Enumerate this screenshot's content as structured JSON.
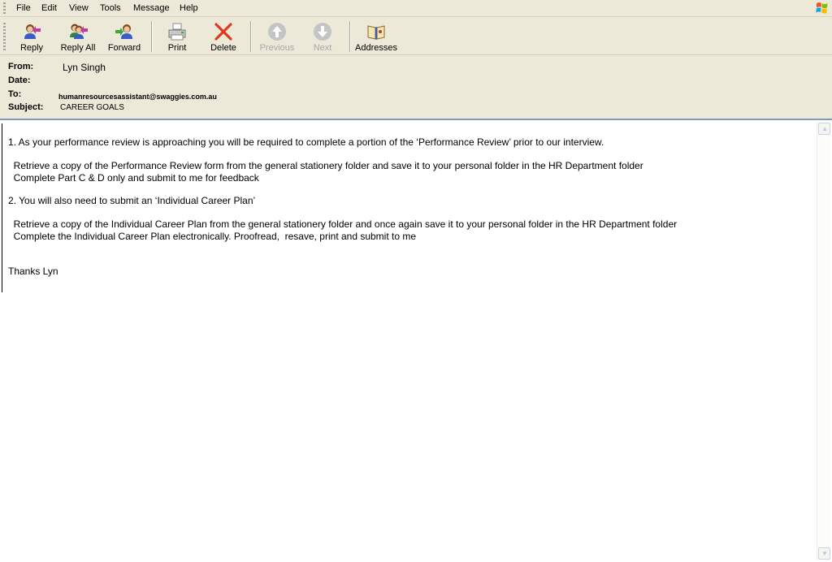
{
  "menu": {
    "items": [
      "File",
      "Edit",
      "View",
      "Tools",
      "Message",
      "Help"
    ]
  },
  "toolbar": {
    "reply": "Reply",
    "reply_all": "Reply All",
    "forward": "Forward",
    "print": "Print",
    "delete": "Delete",
    "previous": "Previous",
    "next": "Next",
    "addresses": "Addresses"
  },
  "header": {
    "from_label": "From:",
    "from_value": "Lyn Singh",
    "date_label": "Date:",
    "date_value": "",
    "to_label": "To:",
    "to_value": "humanresourcesassistant@swaggies.com.au",
    "subject_label": "Subject:",
    "subject_value": "CAREER GOALS"
  },
  "message": {
    "line1": "1. As your performance review is approaching you will be required to complete a portion of the ‘Performance Review’ prior to our interview.",
    "line2": "  Retrieve a copy of the Performance Review form from the general stationery folder and save it to your personal folder in the HR Department folder",
    "line3": "  Complete Part C & D only and submit to me for feedback",
    "line4": "2. You will also need to submit an ‘Individual Career Plan’",
    "line5": "  Retrieve a copy of the Individual Career Plan from the general stationery folder and once again save it to your personal folder in the HR Department folder",
    "line6": "  Complete the Individual Career Plan electronically. Proofread,  resave, print and submit to me",
    "signoff": "Thanks Lyn"
  },
  "colors": {
    "chrome": "#ece9d8",
    "delete_red": "#e03a1e",
    "disabled_gray": "#a7a6aa"
  }
}
